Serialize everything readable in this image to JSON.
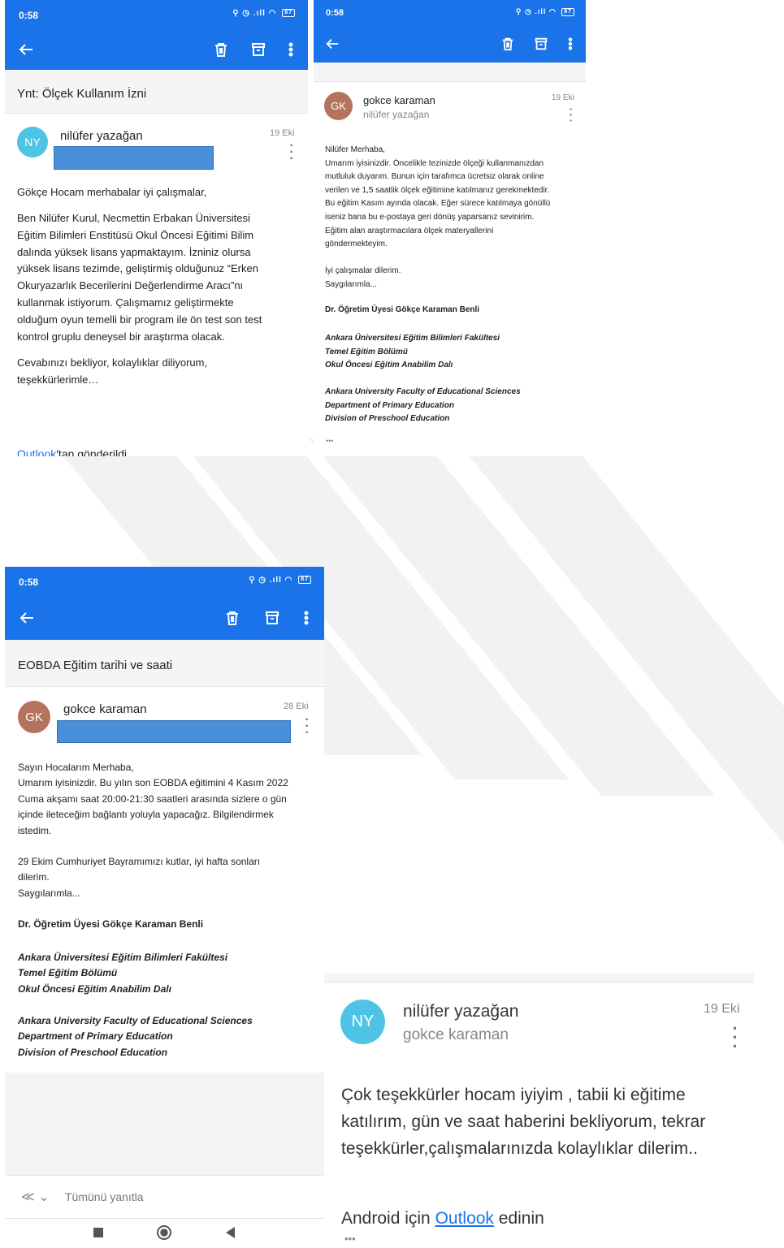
{
  "status": {
    "time": "0:58",
    "battery": "87"
  },
  "email1": {
    "subject": "Ynt: Ölçek Kullanım İzni",
    "avatar": "NY",
    "sender": "nilüfer yazağan",
    "date": "19 Eki",
    "greeting": "Gökçe Hocam merhabalar iyi çalışmalar,",
    "body": "Ben Nilüfer Kurul, Necmettin Erbakan Üniversitesi\nEğitim Bilimleri Enstitüsü Okul Öncesi Eğitimi Bilim\ndalında yüksek lisans yapmaktayım. İzniniz olursa\nyüksek lisans tezimde, geliştirmiş olduğunuz “Erken\nOkuryazarlık Becerilerini Değerlendirme Aracı”nı\nkullanmak istiyorum. Çalışmamız geliştirmekte\nolduğum oyun temelli bir program ile ön test son test\nkontrol gruplu deneysel bir araştırma olacak.",
    "closing": "Cevabınızı bekliyor, kolaylıklar diliyorum,\nteşekkürlerimle…",
    "footer_link": "Outlook",
    "footer_text": "'tan gönderildi"
  },
  "email2": {
    "avatar": "GK",
    "sender": "gokce karaman",
    "recipient": "nilüfer yazağan",
    "date": "19 Eki",
    "body": "Nilüfer Merhaba,\nUmarım iyisinizdir. Öncelikle tezinizde ölçeği kullanmanızdan\nmutluluk duyarım. Bunun için tarafımca ücretsiz olarak online\nverilen ve 1,5 saatlik ölçek eğitimine katılmanız gerekmektedir.\nBu eğitim Kasım ayında olacak. Eğer sürece katılmaya gönüllü\niseniz bana bu e-postaya geri dönüş yaparsanız sevinirim.\nEğitim alan araştırmacılara ölçek materyallerini\ngöndermekteyim.",
    "closing": "İyi çalışmalar dilerim.\nSaygılarımla...",
    "sig_name": "Dr. Öğretim Üyesi Gökçe Karaman Benli",
    "sig_tr": "Ankara Üniversitesi Eğitim Bilimleri Fakültesi\nTemel Eğitim Bölümü\nOkul Öncesi Eğitim Anabilim Dalı",
    "sig_en": "Ankara University Faculty of Educational Sciences\nDepartment of Primary Education\nDivision of Preschool Education",
    "more": "•••"
  },
  "email3": {
    "subject": "EOBDA Eğitim tarihi ve saati",
    "avatar": "GK",
    "sender": "gokce karaman",
    "date": "28 Eki",
    "body": "Sayın Hocalarım Merhaba,\nUmarım iyisinizdir. Bu yılın son EOBDA eğitimini 4 Kasım 2022\nCuma akşamı saat 20:00-21:30 saatleri arasında sizlere o gün\niçinde ileteceğim bağlantı yoluyla yapacağız. Bilgilendirmek\nistedim.",
    "closing": "29 Ekim Cumhuriyet Bayramımızı kutlar, iyi hafta sonları\ndilerim.\nSaygılarımla...",
    "sig_name": "Dr. Öğretim Üyesi Gökçe Karaman Benli",
    "sig_tr": "Ankara Üniversitesi Eğitim Bilimleri Fakültesi\nTemel Eğitim Bölümü\nOkul Öncesi Eğitim Anabilim Dalı",
    "sig_en": "Ankara University Faculty of Educational Sciences\nDepartment of Primary Education\nDivision of Preschool Education",
    "reply_all": "Tümünü yanıtla"
  },
  "email4": {
    "avatar": "NY",
    "sender": "nilüfer yazağan",
    "recipient": "gokce karaman",
    "date": "19 Eki",
    "body": "Çok teşekkürler hocam iyiyim , tabii ki eğitime\nkatılırım, gün ve saat haberini bekliyorum, tekrar\nteşekkürler,çalışmalarınızda kolaylıklar dilerim..",
    "footer_pre": "Android için ",
    "footer_link": "Outlook",
    "footer_post": " edinin",
    "more": "•••"
  }
}
